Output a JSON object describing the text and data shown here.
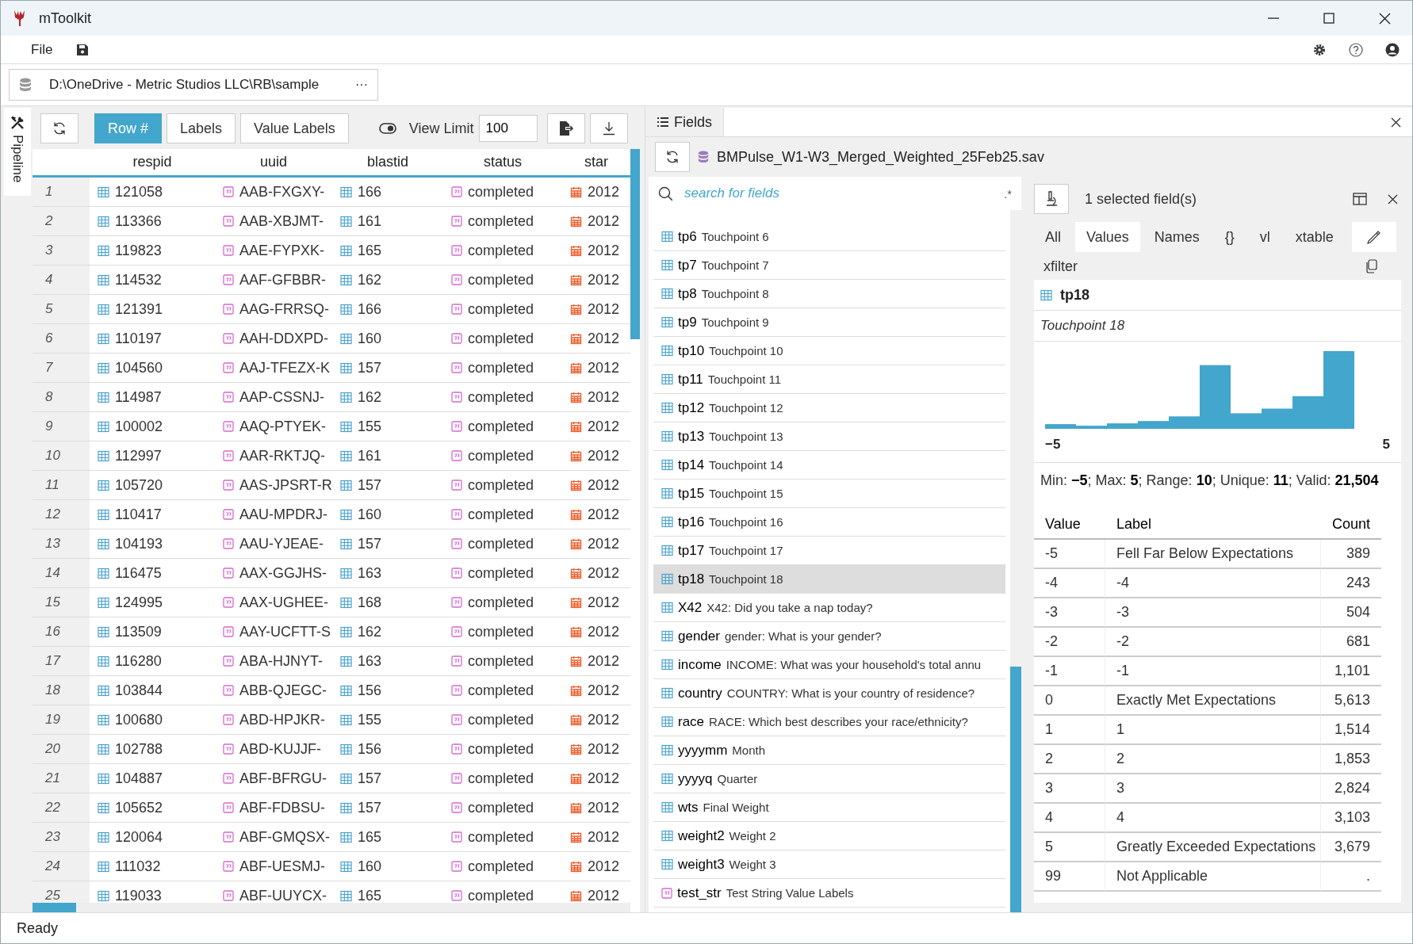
{
  "window": {
    "title": "mToolkit"
  },
  "menu": [
    "File"
  ],
  "source_path": {
    "value": "D:\\OneDrive - Metric Studios LLC\\RB\\sample",
    "more": "···"
  },
  "side_tab": "Pipeline",
  "toolbar": {
    "buttons": [
      {
        "label": "Row #",
        "selected": true
      },
      {
        "label": "Labels",
        "selected": false
      },
      {
        "label": "Value Labels",
        "selected": false
      }
    ],
    "view_limit_label": "View Limit",
    "view_limit": "100"
  },
  "table": {
    "columns": [
      {
        "label": "respid",
        "kind": "numeric"
      },
      {
        "label": "uuid",
        "kind": "string"
      },
      {
        "label": "blastid",
        "kind": "numeric"
      },
      {
        "label": "status",
        "kind": "string"
      },
      {
        "label": "star",
        "kind": "date"
      }
    ],
    "rows": [
      {
        "num": "1",
        "cells": [
          "121058",
          "AAB-FXGXY-",
          "166",
          "completed",
          "2012"
        ]
      },
      {
        "num": "2",
        "cells": [
          "113366",
          "AAB-XBJMT-",
          "161",
          "completed",
          "2012"
        ]
      },
      {
        "num": "3",
        "cells": [
          "119823",
          "AAE-FYPXK-",
          "165",
          "completed",
          "2012"
        ]
      },
      {
        "num": "4",
        "cells": [
          "114532",
          "AAF-GFBBR-",
          "162",
          "completed",
          "2012"
        ]
      },
      {
        "num": "5",
        "cells": [
          "121391",
          "AAG-FRRSQ-",
          "166",
          "completed",
          "2012"
        ]
      },
      {
        "num": "6",
        "cells": [
          "110197",
          "AAH-DDXPD-",
          "160",
          "completed",
          "2012"
        ]
      },
      {
        "num": "7",
        "cells": [
          "104560",
          "AAJ-TFEZX-K",
          "157",
          "completed",
          "2012"
        ]
      },
      {
        "num": "8",
        "cells": [
          "114987",
          "AAP-CSSNJ-",
          "162",
          "completed",
          "2012"
        ]
      },
      {
        "num": "9",
        "cells": [
          "100002",
          "AAQ-PTYEK-",
          "155",
          "completed",
          "2012"
        ]
      },
      {
        "num": "10",
        "cells": [
          "112997",
          "AAR-RKTJQ-",
          "161",
          "completed",
          "2012"
        ]
      },
      {
        "num": "11",
        "cells": [
          "105720",
          "AAS-JPSRT-R",
          "157",
          "completed",
          "2012"
        ]
      },
      {
        "num": "12",
        "cells": [
          "110417",
          "AAU-MPDRJ-",
          "160",
          "completed",
          "2012"
        ]
      },
      {
        "num": "13",
        "cells": [
          "104193",
          "AAU-YJEAE-",
          "157",
          "completed",
          "2012"
        ]
      },
      {
        "num": "14",
        "cells": [
          "116475",
          "AAX-GGJHS-",
          "163",
          "completed",
          "2012"
        ]
      },
      {
        "num": "15",
        "cells": [
          "124995",
          "AAX-UGHEE-",
          "168",
          "completed",
          "2012"
        ]
      },
      {
        "num": "16",
        "cells": [
          "113509",
          "AAY-UCFTT-S",
          "162",
          "completed",
          "2012"
        ]
      },
      {
        "num": "17",
        "cells": [
          "116280",
          "ABA-HJNYT-",
          "163",
          "completed",
          "2012"
        ]
      },
      {
        "num": "18",
        "cells": [
          "103844",
          "ABB-QJEGC-",
          "156",
          "completed",
          "2012"
        ]
      },
      {
        "num": "19",
        "cells": [
          "100680",
          "ABD-HPJKR-",
          "155",
          "completed",
          "2012"
        ]
      },
      {
        "num": "20",
        "cells": [
          "102788",
          "ABD-KUJJF-",
          "156",
          "completed",
          "2012"
        ]
      },
      {
        "num": "21",
        "cells": [
          "104887",
          "ABF-BFRGU-",
          "157",
          "completed",
          "2012"
        ]
      },
      {
        "num": "22",
        "cells": [
          "105652",
          "ABF-FDBSU-",
          "157",
          "completed",
          "2012"
        ]
      },
      {
        "num": "23",
        "cells": [
          "120064",
          "ABF-GMQSX-",
          "165",
          "completed",
          "2012"
        ]
      },
      {
        "num": "24",
        "cells": [
          "111032",
          "ABF-UESMJ-",
          "160",
          "completed",
          "2012"
        ]
      },
      {
        "num": "25",
        "cells": [
          "119033",
          "ABF-UUYCX-",
          "165",
          "completed",
          "2012"
        ]
      }
    ]
  },
  "fields_panel": {
    "tab": "Fields",
    "file": "BMPulse_W1-W3_Merged_Weighted_25Feb25.sav",
    "search": {
      "placeholder": "search for fields",
      "regex": ".*"
    },
    "fields": [
      {
        "name": "tp6",
        "label": "Touchpoint 6",
        "kind": "numeric",
        "selected": false
      },
      {
        "name": "tp7",
        "label": "Touchpoint 7",
        "kind": "numeric",
        "selected": false
      },
      {
        "name": "tp8",
        "label": "Touchpoint 8",
        "kind": "numeric",
        "selected": false
      },
      {
        "name": "tp9",
        "label": "Touchpoint 9",
        "kind": "numeric",
        "selected": false
      },
      {
        "name": "tp10",
        "label": "Touchpoint 10",
        "kind": "numeric",
        "selected": false
      },
      {
        "name": "tp11",
        "label": "Touchpoint 11",
        "kind": "numeric",
        "selected": false
      },
      {
        "name": "tp12",
        "label": "Touchpoint 12",
        "kind": "numeric",
        "selected": false
      },
      {
        "name": "tp13",
        "label": "Touchpoint 13",
        "kind": "numeric",
        "selected": false
      },
      {
        "name": "tp14",
        "label": "Touchpoint 14",
        "kind": "numeric",
        "selected": false
      },
      {
        "name": "tp15",
        "label": "Touchpoint 15",
        "kind": "numeric",
        "selected": false
      },
      {
        "name": "tp16",
        "label": "Touchpoint 16",
        "kind": "numeric",
        "selected": false
      },
      {
        "name": "tp17",
        "label": "Touchpoint 17",
        "kind": "numeric",
        "selected": false
      },
      {
        "name": "tp18",
        "label": "Touchpoint 18",
        "kind": "numeric",
        "selected": true
      },
      {
        "name": "X42",
        "label": "X42: Did you take a nap today?",
        "kind": "numeric",
        "selected": false
      },
      {
        "name": "gender",
        "label": "gender: What is your gender?",
        "kind": "numeric",
        "selected": false
      },
      {
        "name": "income",
        "label": "INCOME: What was your household's total annu",
        "kind": "numeric",
        "selected": false
      },
      {
        "name": "country",
        "label": "COUNTRY: What is your country of residence?",
        "kind": "numeric",
        "selected": false
      },
      {
        "name": "race",
        "label": "RACE: Which best describes your race/ethnicity?",
        "kind": "numeric",
        "selected": false
      },
      {
        "name": "yyyymm",
        "label": "Month",
        "kind": "numeric",
        "selected": false
      },
      {
        "name": "yyyyq",
        "label": "Quarter",
        "kind": "numeric",
        "selected": false
      },
      {
        "name": "wts",
        "label": "Final Weight",
        "kind": "numeric",
        "selected": false
      },
      {
        "name": "weight2",
        "label": "Weight 2",
        "kind": "numeric",
        "selected": false
      },
      {
        "name": "weight3",
        "label": "Weight 3",
        "kind": "numeric",
        "selected": false
      },
      {
        "name": "test_str",
        "label": "Test String Value Labels",
        "kind": "string",
        "selected": false
      }
    ]
  },
  "detail": {
    "summary": "1 selected field(s)",
    "tabs": [
      {
        "label": "All",
        "selected": false
      },
      {
        "label": "Values",
        "selected": true
      },
      {
        "label": "Names",
        "selected": false
      },
      {
        "label": "{}",
        "selected": false
      },
      {
        "label": "vl",
        "selected": false
      },
      {
        "label": "xtable",
        "selected": false
      }
    ],
    "filter_tab": "xfilter",
    "field": {
      "name": "tp18",
      "label": "Touchpoint 18"
    },
    "histogram": {
      "axis_min": "−5",
      "axis_max": "5"
    },
    "stats": "Min: **−5**; Max: **5**; Range: **10**; Unique: **11**; Valid: **21,504**",
    "values": {
      "columns": [
        "Value",
        "Label",
        "Count"
      ],
      "rows": [
        [
          "-5",
          "Fell Far Below Expectations",
          "389"
        ],
        [
          "-4",
          "-4",
          "243"
        ],
        [
          "-3",
          "-3",
          "504"
        ],
        [
          "-2",
          "-2",
          "681"
        ],
        [
          "-1",
          "-1",
          "1,101"
        ],
        [
          "0",
          "Exactly Met Expectations",
          "5,613"
        ],
        [
          "1",
          "1",
          "1,514"
        ],
        [
          "2",
          "2",
          "1,853"
        ],
        [
          "3",
          "3",
          "2,824"
        ],
        [
          "4",
          "4",
          "3,103"
        ],
        [
          "5",
          "Greatly Exceeded Expectations",
          "3,679"
        ],
        [
          "99",
          "Not Applicable",
          "."
        ]
      ]
    }
  },
  "status_bar": "Ready"
}
